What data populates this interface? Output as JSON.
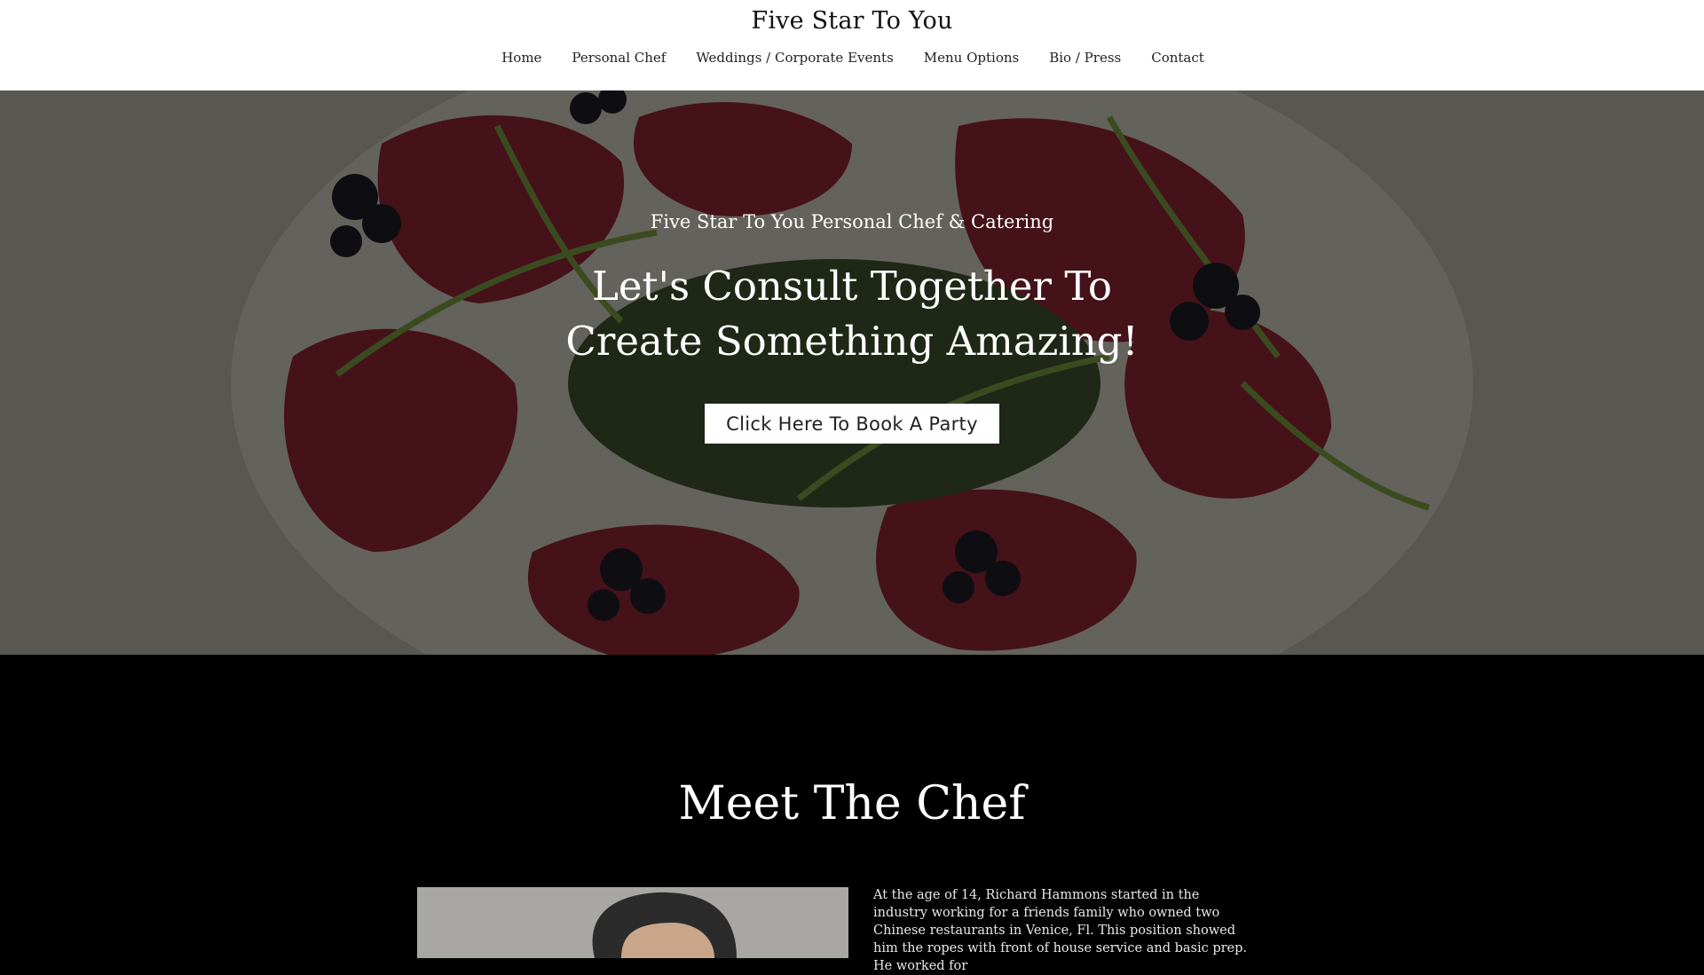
{
  "header": {
    "site_title": "Five Star To You",
    "nav": [
      "Home",
      "Personal Chef",
      "Weddings / Corporate Events",
      "Menu Options",
      "Bio / Press",
      "Contact"
    ]
  },
  "hero": {
    "subtitle": "Five Star To You Personal Chef & Catering",
    "title_line1": "Let's Consult Together To",
    "title_line2": "Create Something Amazing!",
    "cta_label": "Click Here To Book A Party"
  },
  "meet": {
    "title": "Meet The Chef",
    "bio": "At the age of 14, Richard Hammons started in the industry working for a friends family who owned two Chinese restaurants in Venice, Fl. This position showed him the ropes with front of house service and basic prep. He worked for"
  },
  "colors": {
    "header_bg": "#ffffff",
    "page_bg": "#000000",
    "button_bg": "#ffffff"
  }
}
